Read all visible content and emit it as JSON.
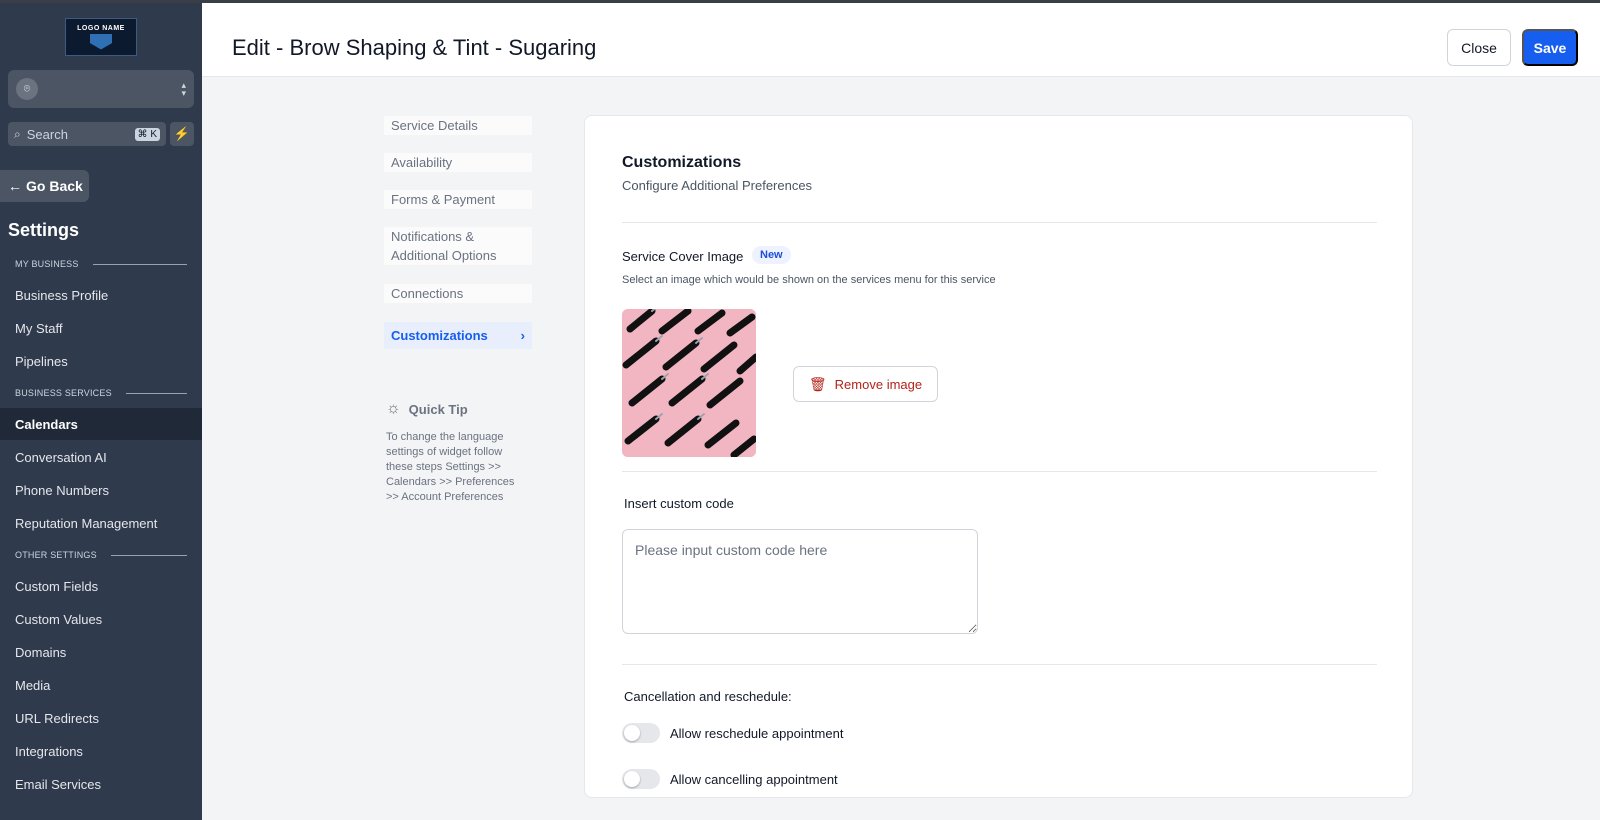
{
  "sidebar": {
    "logo_text": "LOGO NAME",
    "search_label": "Search",
    "search_shortcut": "⌘ K",
    "go_back": "Go Back",
    "settings_title": "Settings",
    "sections": {
      "my_business": "MY BUSINESS",
      "business_services": "BUSINESS SERVICES",
      "other_settings": "OTHER SETTINGS"
    },
    "items": {
      "business_profile": "Business Profile",
      "my_staff": "My Staff",
      "pipelines": "Pipelines",
      "calendars": "Calendars",
      "conversation_ai": "Conversation AI",
      "phone_numbers": "Phone Numbers",
      "reputation_management": "Reputation Management",
      "custom_fields": "Custom Fields",
      "custom_values": "Custom Values",
      "domains": "Domains",
      "media": "Media",
      "url_redirects": "URL Redirects",
      "integrations": "Integrations",
      "email_services": "Email Services"
    }
  },
  "header": {
    "title": "Edit - Brow Shaping & Tint - Sugaring",
    "close_label": "Close",
    "save_label": "Save"
  },
  "subnav": {
    "service_details": "Service Details",
    "availability": "Availability",
    "forms_payment": "Forms & Payment",
    "notifications": "Notifications & Additional Options",
    "connections": "Connections",
    "customizations": "Customizations"
  },
  "quick_tip": {
    "title": "Quick Tip",
    "body": "To change the language settings of widget follow these steps Settings >> Calendars >> Preferences >> Account Preferences"
  },
  "card": {
    "title": "Customizations",
    "subtitle": "Configure Additional Preferences",
    "cover_label": "Service Cover Image",
    "cover_badge": "New",
    "cover_help": "Select an image which would be shown on the services menu for this service",
    "remove_label": "Remove image",
    "code_label": "Insert custom code",
    "code_value": "",
    "code_placeholder": "Please input custom code here",
    "cancel_heading": "Cancellation and reschedule:",
    "toggle_reschedule": "Allow reschedule appointment",
    "toggle_cancel": "Allow cancelling appointment",
    "toggle_reschedule_on": false,
    "toggle_cancel_on": false
  },
  "colors": {
    "sidebar_bg": "#2f3a4c",
    "accent": "#155eef",
    "danger": "#b42318",
    "cover_pink": "#f2b6c2"
  }
}
